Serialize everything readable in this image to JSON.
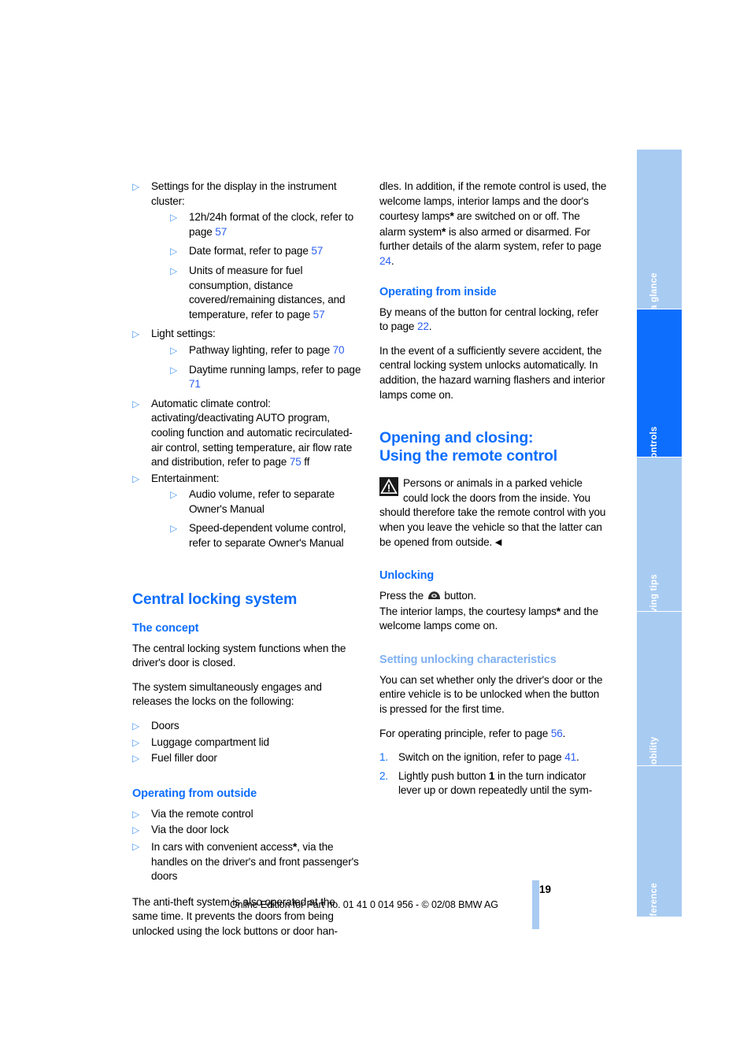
{
  "page": {
    "number": "19",
    "footer_note": "Online Edition for Part no. 01 41 0 014 956 - © 02/08 BMW AG"
  },
  "colors": {
    "heading_blue": "#0d6efd",
    "heading_blue_light": "#80b1f2",
    "bullet_blue": "#4d9bf5",
    "page_ref_blue": "#2b5ef0",
    "tab_inactive": "#a8cbf2",
    "tab_active": "#0d6efd"
  },
  "sidebar": {
    "tabs": [
      {
        "label": "At a glance",
        "active": false
      },
      {
        "label": "Controls",
        "active": true
      },
      {
        "label": "Driving tips",
        "active": false
      },
      {
        "label": "Mobility",
        "active": false
      },
      {
        "label": "Reference",
        "active": false
      }
    ]
  },
  "left_column": {
    "bullets": [
      {
        "text": "Settings for the display in the instrument cluster:",
        "children": [
          "12h/24h format of the clock, refer to page 57",
          "Date format, refer to page 57",
          "Units of measure for fuel consumption, distance covered/remaining distances, and temperature, refer to page 57"
        ]
      },
      {
        "text": "Light settings:",
        "children": [
          "Pathway lighting, refer to page 70",
          "Daytime running lamps, refer to page 71"
        ]
      },
      {
        "text": "Automatic climate control: activating/deactivating AUTO program, cooling function and automatic recirculated-air control, setting temperature, air flow rate and distribution, refer to page 75 ff",
        "children": []
      },
      {
        "text": "Entertainment:",
        "children": [
          "Audio volume, refer to separate Owner's Manual",
          "Speed-dependent volume control, refer to separate Owner's Manual"
        ]
      }
    ],
    "section_title": "Central locking system",
    "concept": {
      "heading": "The concept",
      "p1": "The central locking system functions when the driver's door is closed.",
      "p2": "The system simultaneously engages and releases the locks on the following:",
      "items": [
        "Doors",
        "Luggage compartment lid",
        "Fuel filler door"
      ]
    },
    "outside": {
      "heading": "Operating from outside",
      "items": [
        "Via the remote control",
        "Via the door lock",
        "In cars with convenient access*, via the handles on the driver's and front passenger's doors"
      ],
      "p1": "The anti-theft system is also operated at the same time. It prevents the doors from being unlocked using the lock buttons or door han-"
    }
  },
  "right_column": {
    "continuation": "dles. In addition, if the remote control is used, the welcome lamps, interior lamps and the door's courtesy lamps* are switched on or off. The alarm system* is also armed or disarmed. For further details of the alarm system, refer to page 24.",
    "inside": {
      "heading": "Operating from inside",
      "p1": "By means of the button for central locking, refer to page 22.",
      "p2": "In the event of a sufficiently severe accident, the central locking system unlocks automatically. In addition, the hazard warning flashers and interior lamps come on."
    },
    "section_title_line1": "Opening and closing:",
    "section_title_line2": "Using the remote control",
    "warning": {
      "icon": "warning-triangle-icon",
      "text": "Persons or animals in a parked vehicle could lock the doors from the inside. You should therefore take the remote control with you when you leave the vehicle so that the latter can be opened from outside.",
      "end_mark": "◀"
    },
    "unlocking": {
      "heading": "Unlocking",
      "p1_before": "Press the",
      "p1_after": "button.",
      "p2": "The interior lamps, the courtesy lamps* and the welcome lamps come on."
    },
    "characteristics": {
      "heading": "Setting unlocking characteristics",
      "p1": "You can set whether only the driver's door or the entire vehicle is to be unlocked when the button is pressed for the first time.",
      "p2": "For operating principle, refer to page 56.",
      "steps": [
        "Switch on the ignition, refer to page 41.",
        "Lightly push button 1 in the turn indicator lever up or down repeatedly until the sym-"
      ]
    }
  }
}
